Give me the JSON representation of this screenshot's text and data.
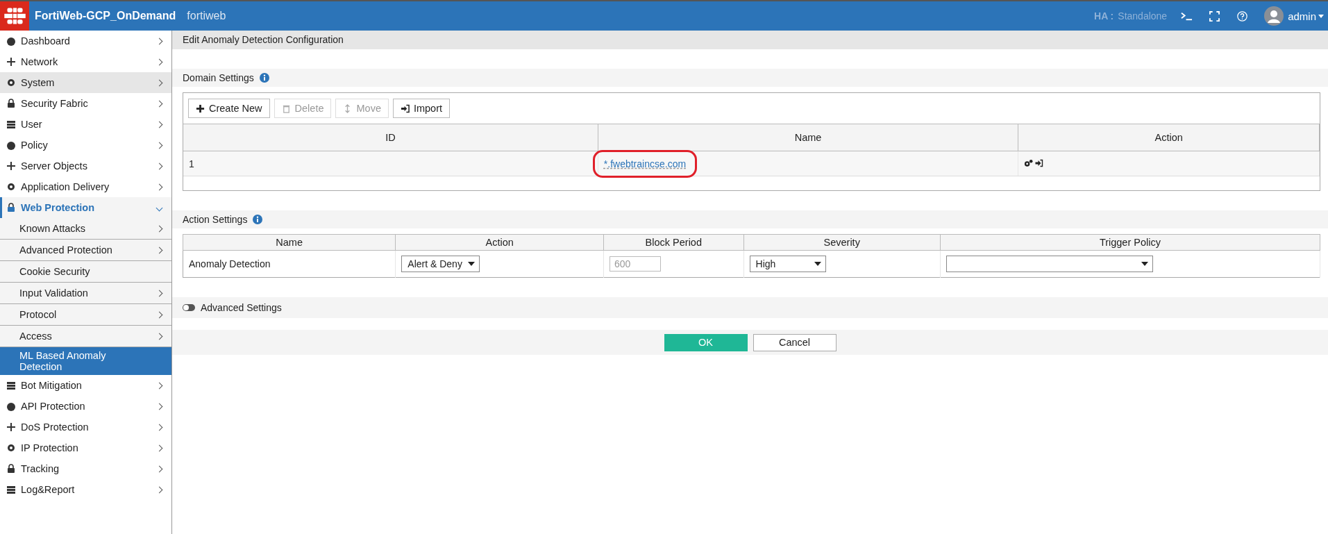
{
  "header": {
    "title": "FortiWeb-GCP_OnDemand",
    "hostname": "fortiweb",
    "ha_label": "HA :",
    "ha_value": "Standalone",
    "user": "admin"
  },
  "sidebar": {
    "items": [
      {
        "label": "Dashboard",
        "expanded": false,
        "selected": false
      },
      {
        "label": "Network",
        "expanded": false,
        "selected": false
      },
      {
        "label": "System",
        "expanded": false,
        "selected": false,
        "hovered": true
      },
      {
        "label": "Security Fabric",
        "expanded": false,
        "selected": false
      },
      {
        "label": "User",
        "expanded": false,
        "selected": false
      },
      {
        "label": "Policy",
        "expanded": false,
        "selected": false
      },
      {
        "label": "Server Objects",
        "expanded": false,
        "selected": false
      },
      {
        "label": "Application Delivery",
        "expanded": false,
        "selected": false
      },
      {
        "label": "Web Protection",
        "expanded": true,
        "selected": false,
        "children": [
          {
            "label": "Known Attacks",
            "submenu": true,
            "selected": false
          },
          {
            "label": "Advanced Protection",
            "submenu": true,
            "selected": false
          },
          {
            "label": "Cookie Security",
            "submenu": false,
            "selected": false
          },
          {
            "label": "Input Validation",
            "submenu": true,
            "selected": false
          },
          {
            "label": "Protocol",
            "submenu": true,
            "selected": false
          },
          {
            "label": "Access",
            "submenu": true,
            "selected": false
          },
          {
            "label": "ML Based Anomaly Detection",
            "submenu": false,
            "selected": true
          }
        ]
      },
      {
        "label": "Bot Mitigation",
        "expanded": false,
        "selected": false
      },
      {
        "label": "API Protection",
        "expanded": false,
        "selected": false
      },
      {
        "label": "DoS Protection",
        "expanded": false,
        "selected": false
      },
      {
        "label": "IP Protection",
        "expanded": false,
        "selected": false
      },
      {
        "label": "Tracking",
        "expanded": false,
        "selected": false
      },
      {
        "label": "Log&Report",
        "expanded": false,
        "selected": false
      }
    ]
  },
  "page_title": "Edit Anomaly Detection Configuration",
  "domain_settings": {
    "title": "Domain Settings",
    "toolbar": [
      {
        "label": "Create New",
        "disabled": false
      },
      {
        "label": "Delete",
        "disabled": true
      },
      {
        "label": "Move",
        "disabled": true
      },
      {
        "label": "Import",
        "disabled": false
      }
    ],
    "table": {
      "columns": [
        "ID",
        "Name",
        "Action"
      ],
      "rows": [
        {
          "id": "1",
          "name": "*.fwebtraincse.com",
          "highlighted": true
        }
      ]
    }
  },
  "action_settings": {
    "title": "Action Settings",
    "table": {
      "columns": [
        "Name",
        "Action",
        "Block Period",
        "Severity",
        "Trigger Policy"
      ],
      "rows": [
        {
          "name": "Anomaly Detection",
          "action": "Alert & Deny",
          "block_period": "600",
          "block_period_disabled": true,
          "severity": "High"
        }
      ]
    }
  },
  "advanced_settings": {
    "label": "Advanced Settings",
    "on": false
  },
  "buttons": [
    {
      "label": "OK",
      "kind": "primary"
    },
    {
      "label": "Cancel",
      "kind": "secondary"
    }
  ]
}
